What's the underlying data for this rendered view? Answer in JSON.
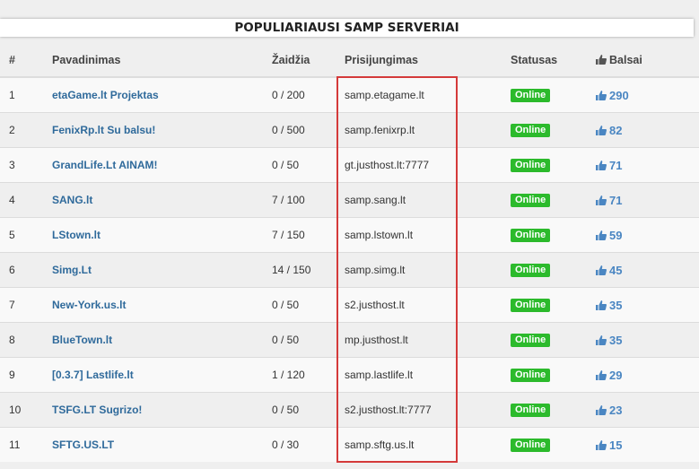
{
  "header": {
    "title": "POPULIARIAUSI SAMP SERVERIAI"
  },
  "columns": {
    "num": "#",
    "name": "Pavadinimas",
    "players": "Žaidžia",
    "connect": "Prisijungimas",
    "status": "Statusas",
    "votes": "Balsai"
  },
  "rows": [
    {
      "num": "1",
      "name": "etaGame.lt Projektas",
      "players": "0 / 200",
      "connect": "samp.etagame.lt",
      "status": "Online",
      "votes": "290"
    },
    {
      "num": "2",
      "name": "FenixRp.lt Su balsu!",
      "players": "0 / 500",
      "connect": "samp.fenixrp.lt",
      "status": "Online",
      "votes": "82"
    },
    {
      "num": "3",
      "name": "GrandLife.Lt AINAM!",
      "players": "0 / 50",
      "connect": "gt.justhost.lt:7777",
      "status": "Online",
      "votes": "71"
    },
    {
      "num": "4",
      "name": "SANG.lt",
      "players": "7 / 100",
      "connect": "samp.sang.lt",
      "status": "Online",
      "votes": "71"
    },
    {
      "num": "5",
      "name": "LStown.lt",
      "players": "7 / 150",
      "connect": "samp.lstown.lt",
      "status": "Online",
      "votes": "59"
    },
    {
      "num": "6",
      "name": "Simg.Lt",
      "players": "14 / 150",
      "connect": "samp.simg.lt",
      "status": "Online",
      "votes": "45"
    },
    {
      "num": "7",
      "name": "New-York.us.lt",
      "players": "0 / 50",
      "connect": "s2.justhost.lt",
      "status": "Online",
      "votes": "35"
    },
    {
      "num": "8",
      "name": "BlueTown.lt",
      "players": "0 / 50",
      "connect": "mp.justhost.lt",
      "status": "Online",
      "votes": "35"
    },
    {
      "num": "9",
      "name": "[0.3.7] Lastlife.lt",
      "players": "1 / 120",
      "connect": "samp.lastlife.lt",
      "status": "Online",
      "votes": "29"
    },
    {
      "num": "10",
      "name": "TSFG.LT Sugrizo!",
      "players": "0 / 50",
      "connect": "s2.justhost.lt:7777",
      "status": "Online",
      "votes": "23"
    },
    {
      "num": "11",
      "name": "SFTG.US.LT",
      "players": "0 / 30",
      "connect": "samp.sftg.us.lt",
      "status": "Online",
      "votes": "15"
    }
  ],
  "icons": {
    "votes": "thumbs-up-icon"
  },
  "colors": {
    "link": "#2f6a9b",
    "online": "#2cba2c",
    "votes": "#4a86c2",
    "highlight": "#d43a3a"
  }
}
